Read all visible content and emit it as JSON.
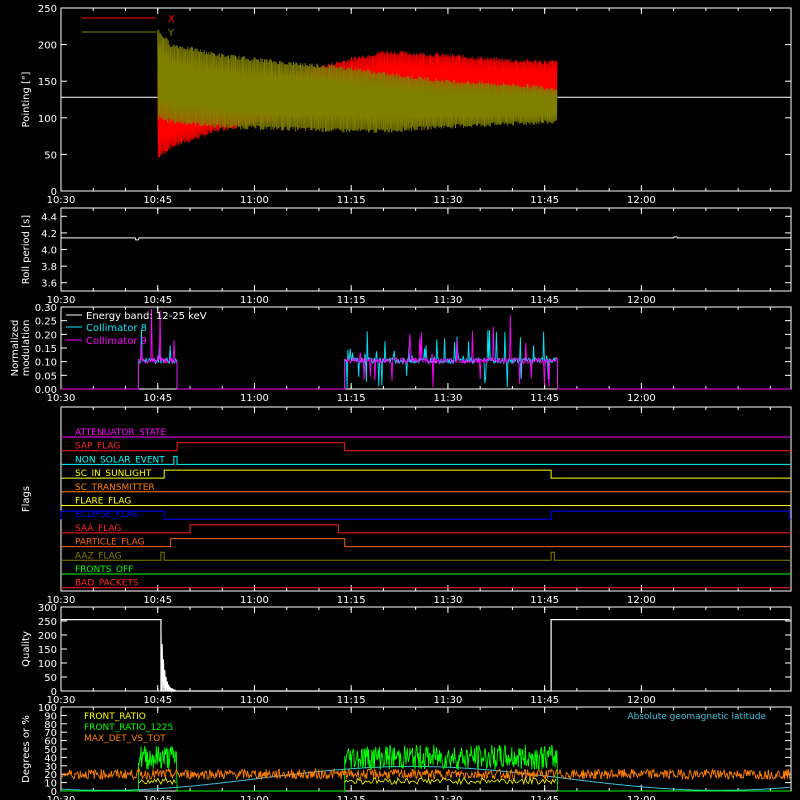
{
  "time_ticks": [
    "10:30",
    "10:45",
    "11:00",
    "11:15",
    "11:30",
    "11:45",
    "12:00"
  ],
  "chart_data": [
    {
      "type": "line",
      "ylabel": "Pointing [\"]",
      "ylim": [
        0,
        250
      ],
      "yticks": [
        "0",
        "50",
        "100",
        "150",
        "200",
        "250"
      ],
      "series": [
        {
          "name": "X",
          "color": "#ff0000",
          "envelope": {
            "x": [
              "10:45",
              "10:47",
              "10:55",
              "11:05",
              "11:15",
              "11:20",
              "11:30",
              "11:40",
              "11:47"
            ],
            "lo": [
              45,
              60,
              85,
              100,
              108,
              112,
              118,
              120,
              122
            ],
            "hi": [
              160,
              135,
              145,
              158,
              180,
              190,
              185,
              178,
              176
            ]
          }
        },
        {
          "name": "Y",
          "color": "#808000",
          "envelope": {
            "x": [
              "10:45",
              "10:47",
              "10:55",
              "11:05",
              "11:15",
              "11:20",
              "11:30",
              "11:40",
              "11:47"
            ],
            "lo": [
              100,
              95,
              88,
              85,
              82,
              82,
              88,
              92,
              94
            ],
            "hi": [
              220,
              200,
              185,
              175,
              168,
              160,
              150,
              145,
              140
            ]
          }
        }
      ],
      "reference_line": 128,
      "legend": "top-left"
    },
    {
      "type": "line",
      "ylabel": "Roll period [s]",
      "ylim": [
        3.5,
        4.5
      ],
      "yticks": [
        "3.6",
        "3.8",
        "4.0",
        "4.2",
        "4.4"
      ],
      "series": [
        {
          "name": "",
          "color": "#ffffff",
          "constant": 4.14
        }
      ]
    },
    {
      "type": "line",
      "ylabel": "Normalized modulation",
      "ylim": [
        0,
        0.3
      ],
      "yticks": [
        "0.00",
        "0.05",
        "0.10",
        "0.15",
        "0.20",
        "0.25",
        "0.30"
      ],
      "legend_title": "Energy band: 12-25 keV",
      "series": [
        {
          "name": "Collimator 8",
          "color": "#00e5ff"
        },
        {
          "name": "Collimator 9",
          "color": "#ff00ff"
        }
      ],
      "active_intervals": [
        [
          "10:42",
          "10:48"
        ],
        [
          "11:14",
          "11:47"
        ]
      ],
      "baseline": 0.1
    },
    {
      "type": "table",
      "ylabel": "Flags",
      "flags": [
        {
          "name": "ATTENUATOR_STATE",
          "color": "#ff00ff",
          "segments": []
        },
        {
          "name": "SAP_FLAG",
          "color": "#ff2020",
          "segments": [
            [
              "10:48",
              "11:14"
            ]
          ]
        },
        {
          "name": "NON_SOLAR_EVENT",
          "color": "#00ffff",
          "segments": [
            [
              "10:47.5",
              "10:48"
            ]
          ]
        },
        {
          "name": "SC_IN_SUNLIGHT",
          "color": "#ffff00",
          "segments": [
            [
              "10:46",
              "11:46"
            ]
          ]
        },
        {
          "name": "SC_TRANSMITTER",
          "color": "#ff8000",
          "segments": []
        },
        {
          "name": "FLARE_FLAG",
          "color": "#ffff00",
          "segments": []
        },
        {
          "name": "ECLIPSE_FLAG",
          "color": "#0000ff",
          "segments": [
            [
              "10:30",
              "10:46"
            ],
            [
              "11:46",
              "12:23"
            ]
          ]
        },
        {
          "name": "SAA_FLAG",
          "color": "#ff2020",
          "segments": [
            [
              "10:50",
              "11:13"
            ]
          ]
        },
        {
          "name": "PARTICLE_FLAG",
          "color": "#ff6000",
          "segments": [
            [
              "10:47",
              "11:14"
            ]
          ]
        },
        {
          "name": "AAZ_FLAG",
          "color": "#808000",
          "segments": [
            [
              "10:45.5",
              "10:46"
            ],
            [
              "11:46",
              "11:46.5"
            ]
          ]
        },
        {
          "name": "FRONTS_OFF",
          "color": "#00ff00",
          "segments": []
        },
        {
          "name": "BAD_PACKETS",
          "color": "#ff2020",
          "segments": []
        }
      ]
    },
    {
      "type": "line",
      "ylabel": "Quality",
      "ylim": [
        0,
        300
      ],
      "yticks": [
        "0",
        "50",
        "100",
        "150",
        "200",
        "250",
        "300"
      ],
      "series": [
        {
          "name": "",
          "color": "#ffffff",
          "points": [
            [
              "10:30",
              255
            ],
            [
              "10:45.5",
              255
            ],
            [
              "10:45.5",
              0
            ],
            [
              "11:46",
              0
            ],
            [
              "11:46",
              255
            ],
            [
              "12:23",
              255
            ]
          ]
        }
      ]
    },
    {
      "type": "line",
      "ylabel": "Degrees or %",
      "ylim": [
        0,
        100
      ],
      "yticks": [
        "0",
        "10",
        "20",
        "30",
        "40",
        "50",
        "60",
        "70",
        "80",
        "90",
        "100"
      ],
      "annotation": "Absolute geomagnetic latitude",
      "series": [
        {
          "name": "FRONT_RATIO",
          "color": "#ffff00"
        },
        {
          "name": "FRONT_RATIO_1225",
          "color": "#00ff00"
        },
        {
          "name": "MAX_DET_VS_TOT",
          "color": "#ff8000"
        }
      ],
      "latitude_color": "#40c0e0"
    }
  ]
}
